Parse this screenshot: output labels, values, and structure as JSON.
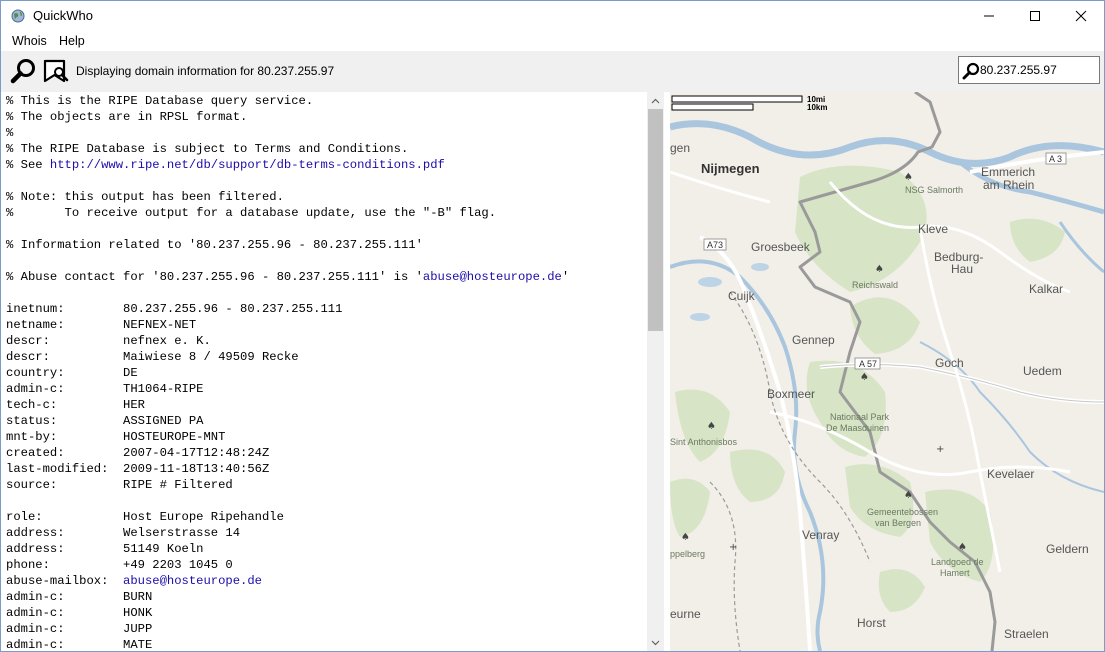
{
  "window": {
    "title": "QuickWho"
  },
  "menu": {
    "whois": "Whois",
    "help": "Help"
  },
  "toolbar": {
    "status": "Displaying domain information for 80.237.255.97",
    "search_value": "80.237.255.97"
  },
  "output": {
    "lines": [
      [
        "% This is the RIPE Database query service."
      ],
      [
        "% The objects are in RPSL format."
      ],
      [
        "%"
      ],
      [
        "% The RIPE Database is subject to Terms and Conditions."
      ],
      [
        "% See ",
        {
          "link": "http://www.ripe.net/db/support/db-terms-conditions.pdf"
        }
      ],
      [
        ""
      ],
      [
        "% Note: this output has been filtered."
      ],
      [
        "%       To receive output for a database update, use the \"-B\" flag."
      ],
      [
        ""
      ],
      [
        "% Information related to '80.237.255.96 - 80.237.255.111'"
      ],
      [
        ""
      ],
      [
        "% Abuse contact for '80.237.255.96 - 80.237.255.111' is '",
        {
          "link": "abuse@hosteurope.de"
        },
        "'"
      ],
      [
        ""
      ],
      [
        "inetnum:        80.237.255.96 - 80.237.255.111"
      ],
      [
        "netname:        NEFNEX-NET"
      ],
      [
        "descr:          nefnex e. K."
      ],
      [
        "descr:          Maiwiese 8 / 49509 Recke"
      ],
      [
        "country:        DE"
      ],
      [
        "admin-c:        TH1064-RIPE"
      ],
      [
        "tech-c:         HER"
      ],
      [
        "status:         ASSIGNED PA"
      ],
      [
        "mnt-by:         HOSTEUROPE-MNT"
      ],
      [
        "created:        2007-04-17T12:48:24Z"
      ],
      [
        "last-modified:  2009-11-18T13:40:56Z"
      ],
      [
        "source:         RIPE # Filtered"
      ],
      [
        ""
      ],
      [
        "role:           Host Europe Ripehandle"
      ],
      [
        "address:        Welserstrasse 14"
      ],
      [
        "address:        51149 Koeln"
      ],
      [
        "phone:          +49 2203 1045 0"
      ],
      [
        "abuse-mailbox:  ",
        {
          "link": "abuse@hosteurope.de"
        }
      ],
      [
        "admin-c:        BURN"
      ],
      [
        "admin-c:        HONK"
      ],
      [
        "admin-c:        JUPP"
      ],
      [
        "admin-c:        MATE"
      ]
    ]
  },
  "map": {
    "scale_mi": "10mi",
    "scale_km": "10km",
    "places": {
      "nijmegen": "Nijmegen",
      "gen": "gen",
      "emmerich": "Emmerich",
      "am_rhein": "am Rhein",
      "nsg_salmorth": "NSG Salmorth",
      "kleve": "Kleve",
      "groesbeek": "Groesbeek",
      "bedburg": "Bedburg-",
      "hau": "Hau",
      "reichswald": "Reichswald",
      "cuijk": "Cuijk",
      "kalkar": "Kalkar",
      "gennep": "Gennep",
      "goch": "Goch",
      "uedem": "Uedem",
      "boxmeer": "Boxmeer",
      "np1": "Nationaal Park",
      "np2": "De Maasduinen",
      "sint_anthonis": "Sint Anthonisbos",
      "kevelaer": "Kevelaer",
      "gem1": "Gemeentebossen",
      "gem2": "van Bergen",
      "venray": "Venray",
      "pelberg": "ppelberg",
      "landgoed1": "Landgoed de",
      "landgoed2": "Hamert",
      "geldern": "Geldern",
      "eurne": "eurne",
      "horst": "Horst",
      "straelen": "Straelen"
    },
    "roads": {
      "a3": "A 3",
      "a73": "A73",
      "a57": "A 57"
    }
  }
}
